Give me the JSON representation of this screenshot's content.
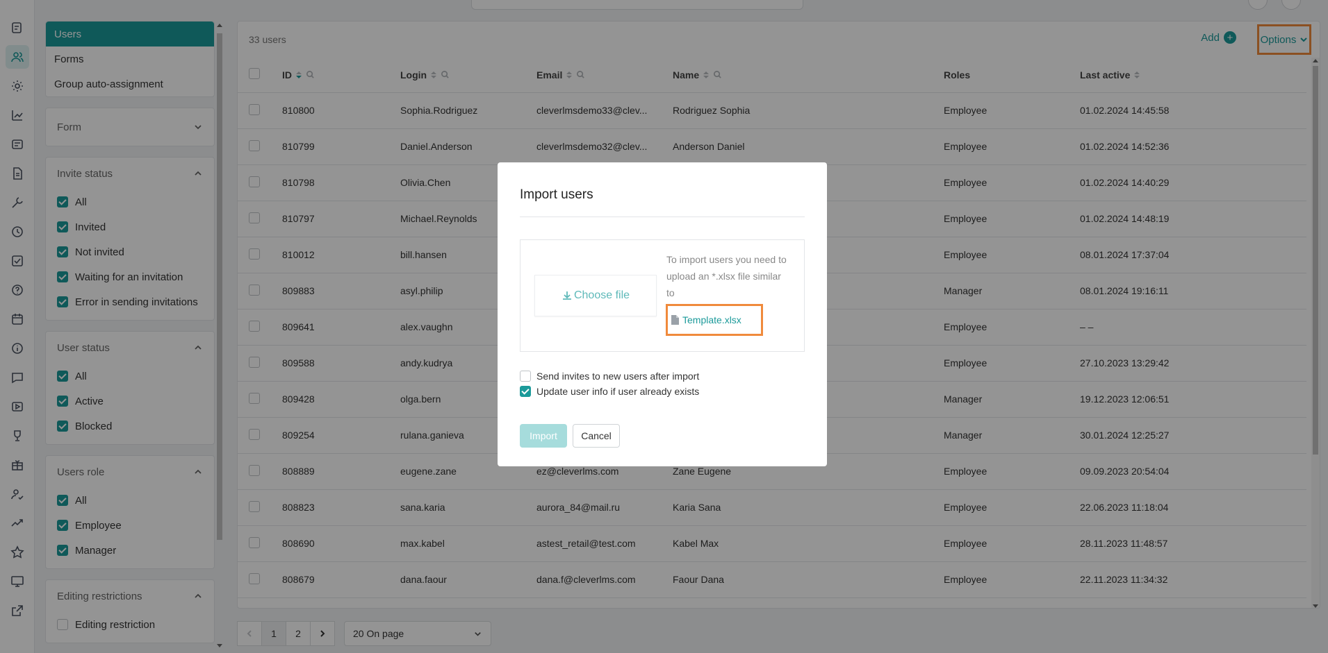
{
  "rail": {
    "items": [
      {
        "icon": "tasks-icon"
      },
      {
        "icon": "users-icon",
        "active": true
      },
      {
        "icon": "gear-icon"
      },
      {
        "icon": "analytics-icon"
      },
      {
        "icon": "course-icon"
      },
      {
        "icon": "document-icon"
      },
      {
        "icon": "tools-icon"
      },
      {
        "icon": "progress-icon"
      },
      {
        "icon": "check-list-icon"
      },
      {
        "icon": "help-icon"
      },
      {
        "icon": "calendar-icon"
      },
      {
        "icon": "info-icon"
      },
      {
        "icon": "chat-icon"
      },
      {
        "icon": "video-icon"
      },
      {
        "icon": "trophy-icon"
      },
      {
        "icon": "gift-icon"
      },
      {
        "icon": "user-check-icon"
      },
      {
        "icon": "trend-icon"
      },
      {
        "icon": "star-icon"
      },
      {
        "icon": "monitor-icon"
      },
      {
        "icon": "external-link-icon"
      }
    ]
  },
  "sidebar": {
    "nav": [
      {
        "label": "Users",
        "active": true
      },
      {
        "label": "Forms"
      },
      {
        "label": "Group auto-assignment"
      }
    ],
    "form_label": "Form",
    "invite_status": {
      "title": "Invite status",
      "items": [
        {
          "label": "All",
          "checked": true
        },
        {
          "label": "Invited",
          "checked": true
        },
        {
          "label": "Not invited",
          "checked": true
        },
        {
          "label": "Waiting for an invitation",
          "checked": true
        },
        {
          "label": "Error in sending invitations",
          "checked": true
        }
      ]
    },
    "user_status": {
      "title": "User status",
      "items": [
        {
          "label": "All",
          "checked": true
        },
        {
          "label": "Active",
          "checked": true
        },
        {
          "label": "Blocked",
          "checked": true
        }
      ]
    },
    "users_role": {
      "title": "Users role",
      "items": [
        {
          "label": "All",
          "checked": true
        },
        {
          "label": "Employee",
          "checked": true
        },
        {
          "label": "Manager",
          "checked": true
        }
      ]
    },
    "editing": {
      "title": "Editing restrictions",
      "items": [
        {
          "label": "Editing restriction",
          "checked": false
        }
      ]
    }
  },
  "main": {
    "count": "33 users",
    "add_label": "Add",
    "options_label": "Options",
    "columns": {
      "id": "ID",
      "login": "Login",
      "email": "Email",
      "name": "Name",
      "roles": "Roles",
      "last_active": "Last active"
    },
    "rows": [
      {
        "id": "810800",
        "login": "Sophia.Rodriguez",
        "email": "cleverlmsdemo33@clev...",
        "name": "Rodriguez Sophia",
        "role": "Employee",
        "last": "01.02.2024 14:45:58"
      },
      {
        "id": "810799",
        "login": "Daniel.Anderson",
        "email": "cleverlmsdemo32@clev...",
        "name": "Anderson Daniel",
        "role": "Employee",
        "last": "01.02.2024 14:52:36"
      },
      {
        "id": "810798",
        "login": "Olivia.Chen",
        "email": "",
        "name": "",
        "role": "Employee",
        "last": "01.02.2024 14:40:29"
      },
      {
        "id": "810797",
        "login": "Michael.Reynolds",
        "email": "",
        "name": "",
        "role": "Employee",
        "last": "01.02.2024 14:48:19"
      },
      {
        "id": "810012",
        "login": "bill.hansen",
        "email": "",
        "name": "",
        "role": "Employee",
        "last": "08.01.2024 17:37:04"
      },
      {
        "id": "809883",
        "login": "asyl.philip",
        "email": "",
        "name": "",
        "role": "Manager",
        "last": "08.01.2024 19:16:11"
      },
      {
        "id": "809641",
        "login": "alex.vaughn",
        "email": "",
        "name": "",
        "role": "Employee",
        "last": "– –"
      },
      {
        "id": "809588",
        "login": "andy.kudrya",
        "email": "",
        "name": "",
        "role": "Employee",
        "last": "27.10.2023 13:29:42"
      },
      {
        "id": "809428",
        "login": "olga.bern",
        "email": "",
        "name": "",
        "role": "Manager",
        "last": "19.12.2023 12:06:51"
      },
      {
        "id": "809254",
        "login": "rulana.ganieva",
        "email": "",
        "name": "",
        "role": "Manager",
        "last": "30.01.2024 12:25:27"
      },
      {
        "id": "808889",
        "login": "eugene.zane",
        "email": "ez@cleverlms.com",
        "name": "Zane Eugene",
        "role": "Employee",
        "last": "09.09.2023 20:54:04"
      },
      {
        "id": "808823",
        "login": "sana.karia",
        "email": "aurora_84@mail.ru",
        "name": "Karia Sana",
        "role": "Employee",
        "last": "22.06.2023 11:18:04"
      },
      {
        "id": "808690",
        "login": "max.kabel",
        "email": "astest_retail@test.com",
        "name": "Kabel Max",
        "role": "Employee",
        "last": "28.11.2023 11:48:57"
      },
      {
        "id": "808679",
        "login": "dana.faour",
        "email": "dana.f@cleverlms.com",
        "name": "Faour Dana",
        "role": "Employee",
        "last": "22.11.2023 11:34:32"
      }
    ]
  },
  "pagination": {
    "pages": [
      "1",
      "2"
    ],
    "current": "1",
    "per_page": "20 On page"
  },
  "modal": {
    "title": "Import users",
    "choose_file": "Choose file",
    "help_text": "To import users you need to upload an *.xlsx file similar to",
    "template_link": "Template.xlsx",
    "send_invites": {
      "label": "Send invites to new users after import",
      "checked": false
    },
    "update_info": {
      "label": "Update user info if user already exists",
      "checked": true
    },
    "import_label": "Import",
    "cancel_label": "Cancel"
  },
  "colors": {
    "accent": "#1b9a9a",
    "highlight": "#f08a3c"
  }
}
